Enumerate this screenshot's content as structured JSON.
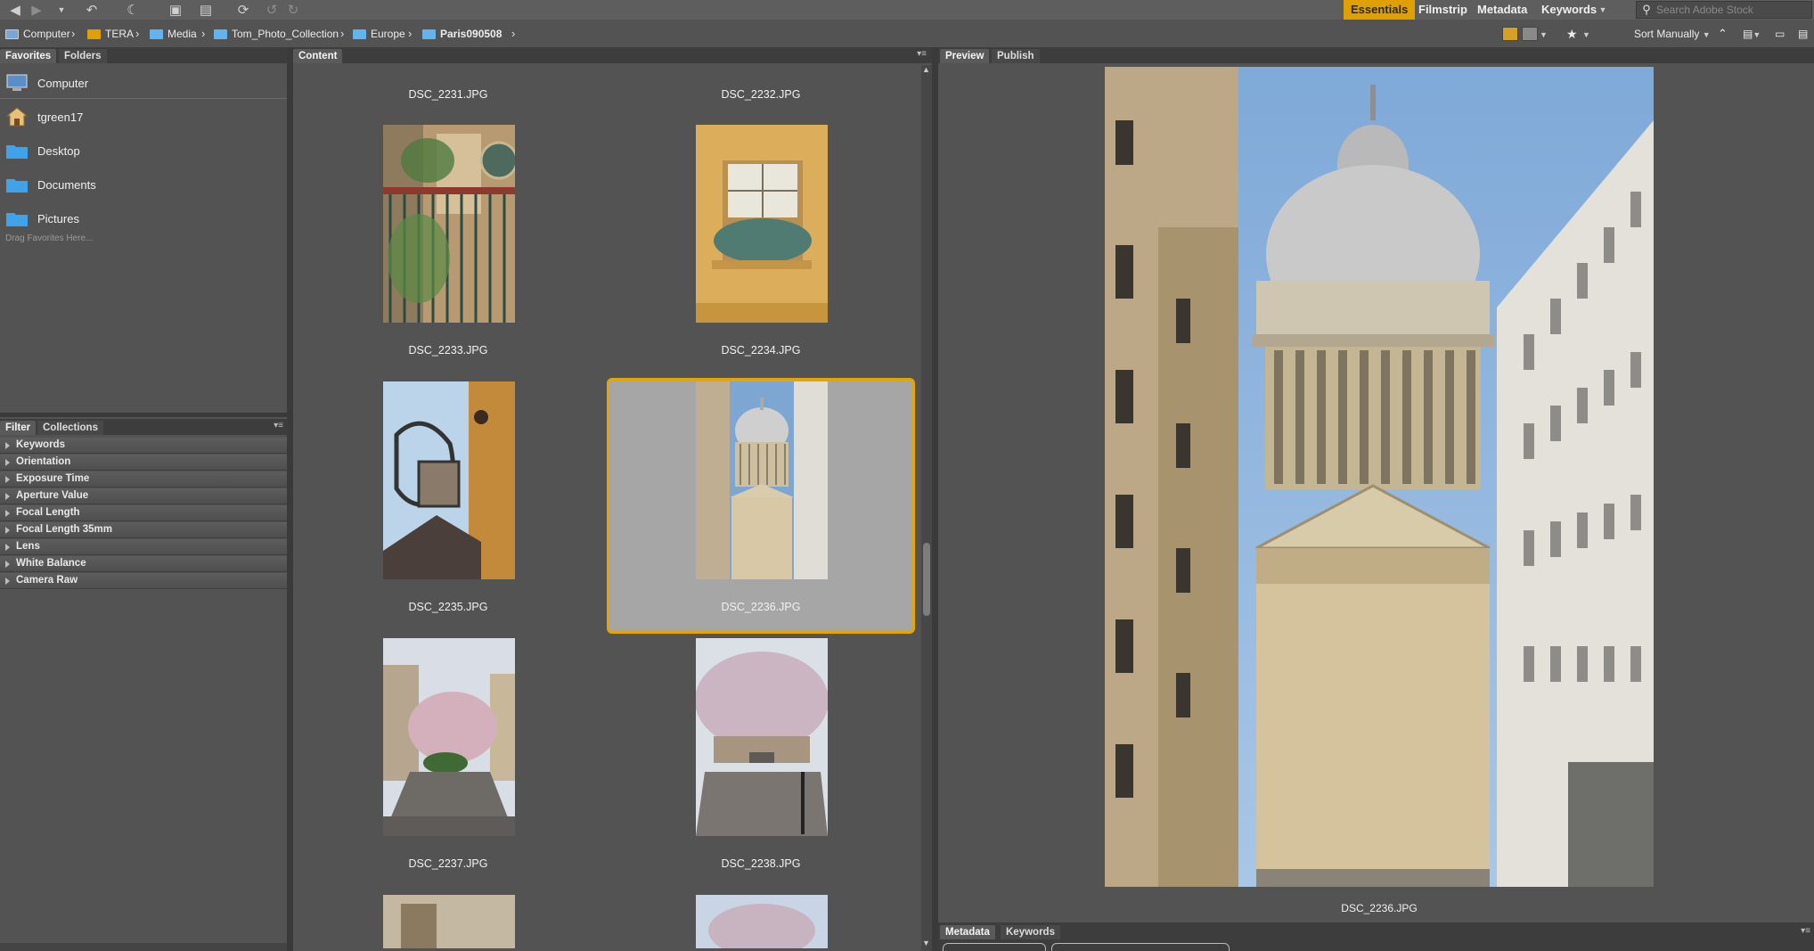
{
  "toolbar": {
    "icons": [
      "back-icon",
      "forward-icon",
      "recent-dropdown-icon",
      "boomerang-icon",
      "camera-icon",
      "refine-icon",
      "open-icon",
      "rotate-left-icon",
      "rotate-right-icon"
    ],
    "workspaces": [
      {
        "label": "Essentials",
        "active": true
      },
      {
        "label": "Filmstrip",
        "active": false
      },
      {
        "label": "Metadata",
        "active": false
      },
      {
        "label": "Keywords",
        "active": false
      }
    ],
    "search_placeholder": "Search Adobe Stock",
    "accent": "#e0a100"
  },
  "breadcrumb": [
    {
      "label": "Computer",
      "icon": "computer-icon",
      "bold": false
    },
    {
      "label": "TERA",
      "icon": "drive-icon",
      "bold": false
    },
    {
      "label": "Media",
      "icon": "folder-icon",
      "bold": false
    },
    {
      "label": "Tom_Photo_Collection",
      "icon": "folder-icon",
      "bold": false
    },
    {
      "label": "Europe",
      "icon": "folder-icon",
      "bold": false
    },
    {
      "label": "Paris090508",
      "icon": "folder-icon",
      "bold": true
    }
  ],
  "pathbar_right": {
    "sort_label": "Sort Manually"
  },
  "left_panel": {
    "tabs": [
      "Favorites",
      "Folders"
    ],
    "favorites": [
      {
        "label": "Computer",
        "icon": "computer-icon"
      },
      {
        "label": "tgreen17",
        "icon": "home-icon"
      },
      {
        "label": "Desktop",
        "icon": "folder-icon"
      },
      {
        "label": "Documents",
        "icon": "folder-icon"
      },
      {
        "label": "Pictures",
        "icon": "folder-icon"
      }
    ],
    "drag_hint": "Drag Favorites Here..."
  },
  "filter_panel": {
    "tabs": [
      "Filter",
      "Collections"
    ],
    "rows": [
      "Keywords",
      "Orientation",
      "Exposure Time",
      "Aperture Value",
      "Focal Length",
      "Focal Length 35mm",
      "Lens",
      "White Balance",
      "Camera Raw"
    ]
  },
  "content_panel": {
    "tab": "Content",
    "files": [
      {
        "name": "DSC_2231.JPG",
        "selected": false
      },
      {
        "name": "DSC_2232.JPG",
        "selected": false
      },
      {
        "name": "DSC_2233.JPG",
        "selected": false
      },
      {
        "name": "DSC_2234.JPG",
        "selected": false
      },
      {
        "name": "DSC_2235.JPG",
        "selected": false
      },
      {
        "name": "DSC_2236.JPG",
        "selected": true
      },
      {
        "name": "DSC_2237.JPG",
        "selected": false
      },
      {
        "name": "DSC_2238.JPG",
        "selected": false
      }
    ]
  },
  "preview_panel": {
    "tabs": [
      "Preview",
      "Publish"
    ],
    "caption": "DSC_2236.JPG"
  },
  "metadata_panel": {
    "tabs": [
      "Metadata",
      "Keywords"
    ]
  }
}
